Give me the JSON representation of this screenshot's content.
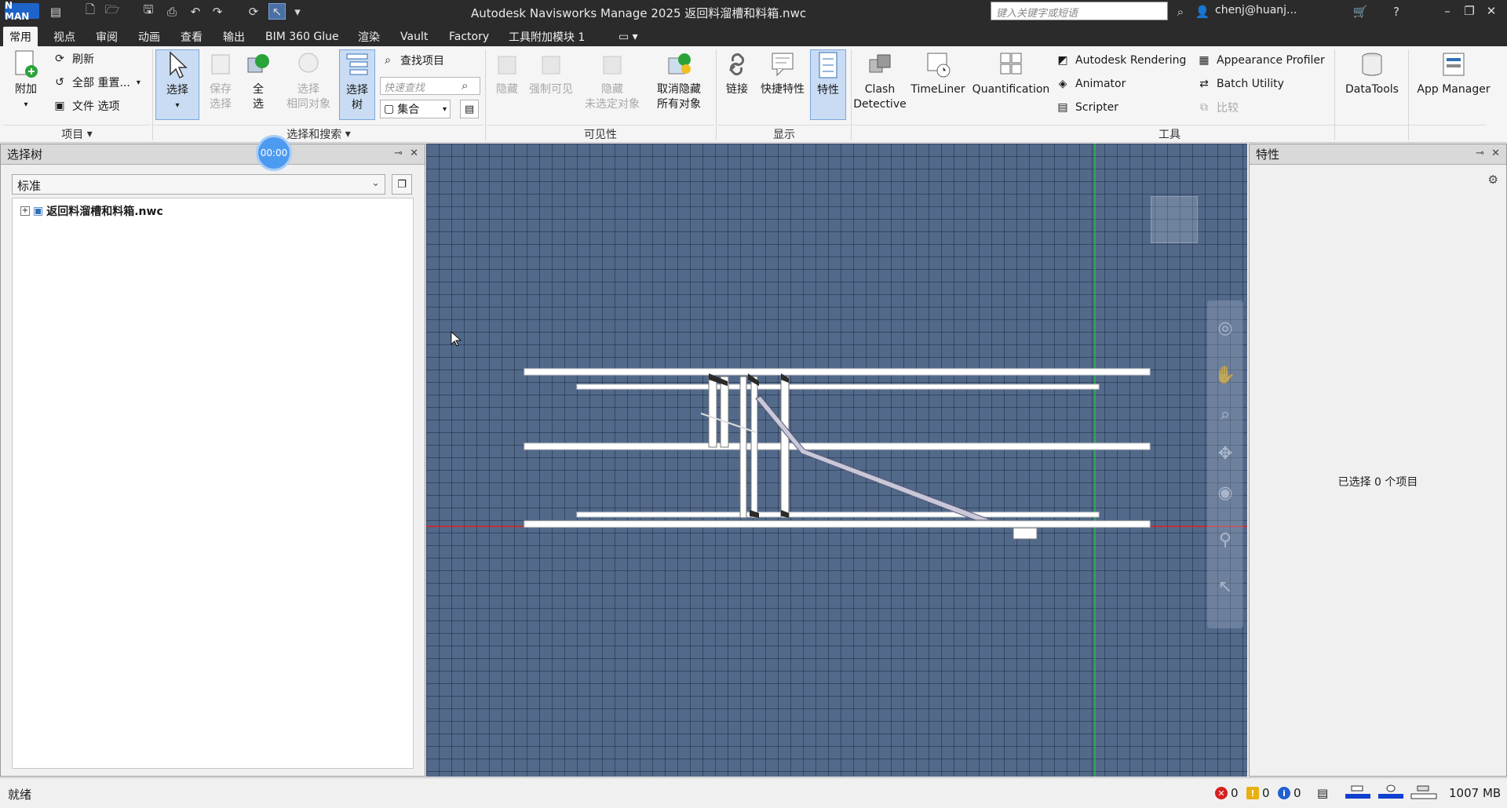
{
  "titlebar": {
    "logo": "N MAN",
    "title": "Autodesk Navisworks Manage 2025    返回料溜槽和料箱.nwc",
    "search_placeholder": "键入关键字或短语",
    "user": "chenj@huanj...",
    "qat_icons": [
      "app-icon",
      "new-icon",
      "open-icon",
      "save-icon",
      "print-icon",
      "undo-icon",
      "redo-icon",
      "refresh-icon",
      "select-icon"
    ]
  },
  "tabs": [
    "常用",
    "视点",
    "审阅",
    "动画",
    "查看",
    "输出",
    "BIM 360 Glue",
    "渲染",
    "Vault",
    "Factory",
    "工具附加模块 1"
  ],
  "active_tab": "常用",
  "ribbon": {
    "project": {
      "append": "附加",
      "refresh": "刷新",
      "reset_all": "全部 重置...",
      "file_options": "文件 选项",
      "group": "项目"
    },
    "select_search": {
      "select": "选择",
      "save_selection": [
        "保存",
        "选择"
      ],
      "select_all": [
        "全",
        "选"
      ],
      "select_same": [
        "选择",
        "相同对象"
      ],
      "selection_tree": [
        "选择",
        "树"
      ],
      "find_items": "查找项目",
      "quick_find_placeholder": "快速查找",
      "sets": "集合",
      "group": "选择和搜索"
    },
    "visibility": {
      "hide": "隐藏",
      "force_visible": "强制可见",
      "hide_unselected": [
        "隐藏",
        "未选定对象"
      ],
      "unhide_all": [
        "取消隐藏",
        "所有对象"
      ],
      "group": "可见性"
    },
    "display": {
      "links": "链接",
      "quick_properties": "快捷特性",
      "properties": "特性",
      "group": "显示"
    },
    "tools": {
      "clash_detective": [
        "Clash",
        "Detective"
      ],
      "timeliner": "TimeLiner",
      "quantification": "Quantification",
      "autodesk_rendering": "Autodesk Rendering",
      "animator": "Animator",
      "scripter": "Scripter",
      "appearance_profiler": "Appearance Profiler",
      "batch_utility": "Batch Utility",
      "compare": "比较",
      "datatools": "DataTools",
      "app_manager": "App Manager",
      "group": "工具"
    }
  },
  "left_panel": {
    "title": "选择树",
    "mode": "标准",
    "tree_root": "返回料溜槽和料箱.nwc",
    "timer": "00:00"
  },
  "right_panel": {
    "title": "特性",
    "empty": "已选择 0 个项目"
  },
  "statusbar": {
    "text": "就绪",
    "errors": "0",
    "warnings": "0",
    "infos": "0",
    "memory": "1007 MB"
  },
  "colors": {
    "viewport_bg": "#52698a",
    "axis_red": "#e02020",
    "axis_green": "#20c040",
    "ribbon_active": "#c9dcf3",
    "titlebar": "#2b2b2b"
  }
}
